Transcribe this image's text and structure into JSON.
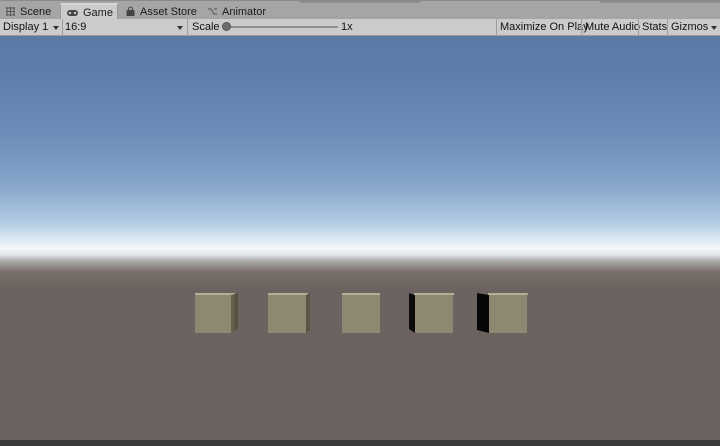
{
  "tabs": [
    {
      "label": "Scene",
      "icon": "grid-icon",
      "active": false
    },
    {
      "label": "Game",
      "icon": "gamepad-icon",
      "active": true
    },
    {
      "label": "Asset Store",
      "icon": "shopping-bag-icon",
      "active": false
    },
    {
      "label": "Animator",
      "icon": "animator-icon",
      "active": false
    }
  ],
  "toolbar": {
    "display": "Display 1",
    "aspect": "16:9",
    "scale_label": "Scale",
    "scale_value": "1x",
    "scale_level": 0.0,
    "maximize_on_play": "Maximize On Play",
    "mute_audio": "Mute Audio",
    "stats": "Stats",
    "gizmos": "Gizmos"
  },
  "scene": {
    "cube_count": 5,
    "sky_color": "#5b7aa6",
    "horizon_color": "#f4f8fb",
    "ground_color": "#6a6260",
    "cube_color": "#8e8771"
  }
}
